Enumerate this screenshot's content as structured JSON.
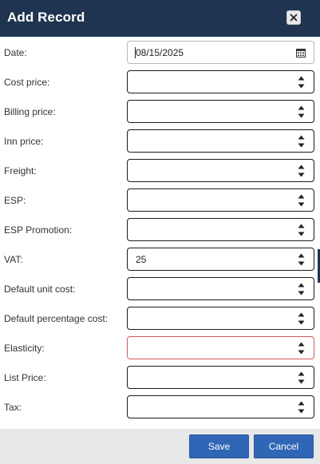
{
  "dialog": {
    "title": "Add Record",
    "close_icon": "close-icon"
  },
  "fields": [
    {
      "label": "Date:",
      "value": "08/15/2025",
      "type": "date"
    },
    {
      "label": "Cost price:",
      "value": "",
      "type": "number"
    },
    {
      "label": "Billing price:",
      "value": "",
      "type": "number"
    },
    {
      "label": "Inn price:",
      "value": "",
      "type": "number"
    },
    {
      "label": "Freight:",
      "value": "",
      "type": "number"
    },
    {
      "label": "ESP:",
      "value": "",
      "type": "number"
    },
    {
      "label": "ESP Promotion:",
      "value": "",
      "type": "number"
    },
    {
      "label": "VAT:",
      "value": "25",
      "type": "number"
    },
    {
      "label": "Default unit cost:",
      "value": "",
      "type": "number"
    },
    {
      "label": "Default percentage cost:",
      "value": "",
      "type": "number"
    },
    {
      "label": "Elasticity:",
      "value": "",
      "type": "number",
      "state": "error"
    },
    {
      "label": "List Price:",
      "value": "",
      "type": "number"
    },
    {
      "label": "Tax:",
      "value": "",
      "type": "number"
    }
  ],
  "buttons": {
    "save_label": "Save",
    "cancel_label": "Cancel"
  },
  "colors": {
    "titlebar": "#1e3450",
    "button": "#2f66b5",
    "footer": "#e8e8e8",
    "error_border": "#d25b5b"
  },
  "icons": {
    "spinner": "spinner-arrows-icon",
    "calendar": "calendar-icon"
  }
}
